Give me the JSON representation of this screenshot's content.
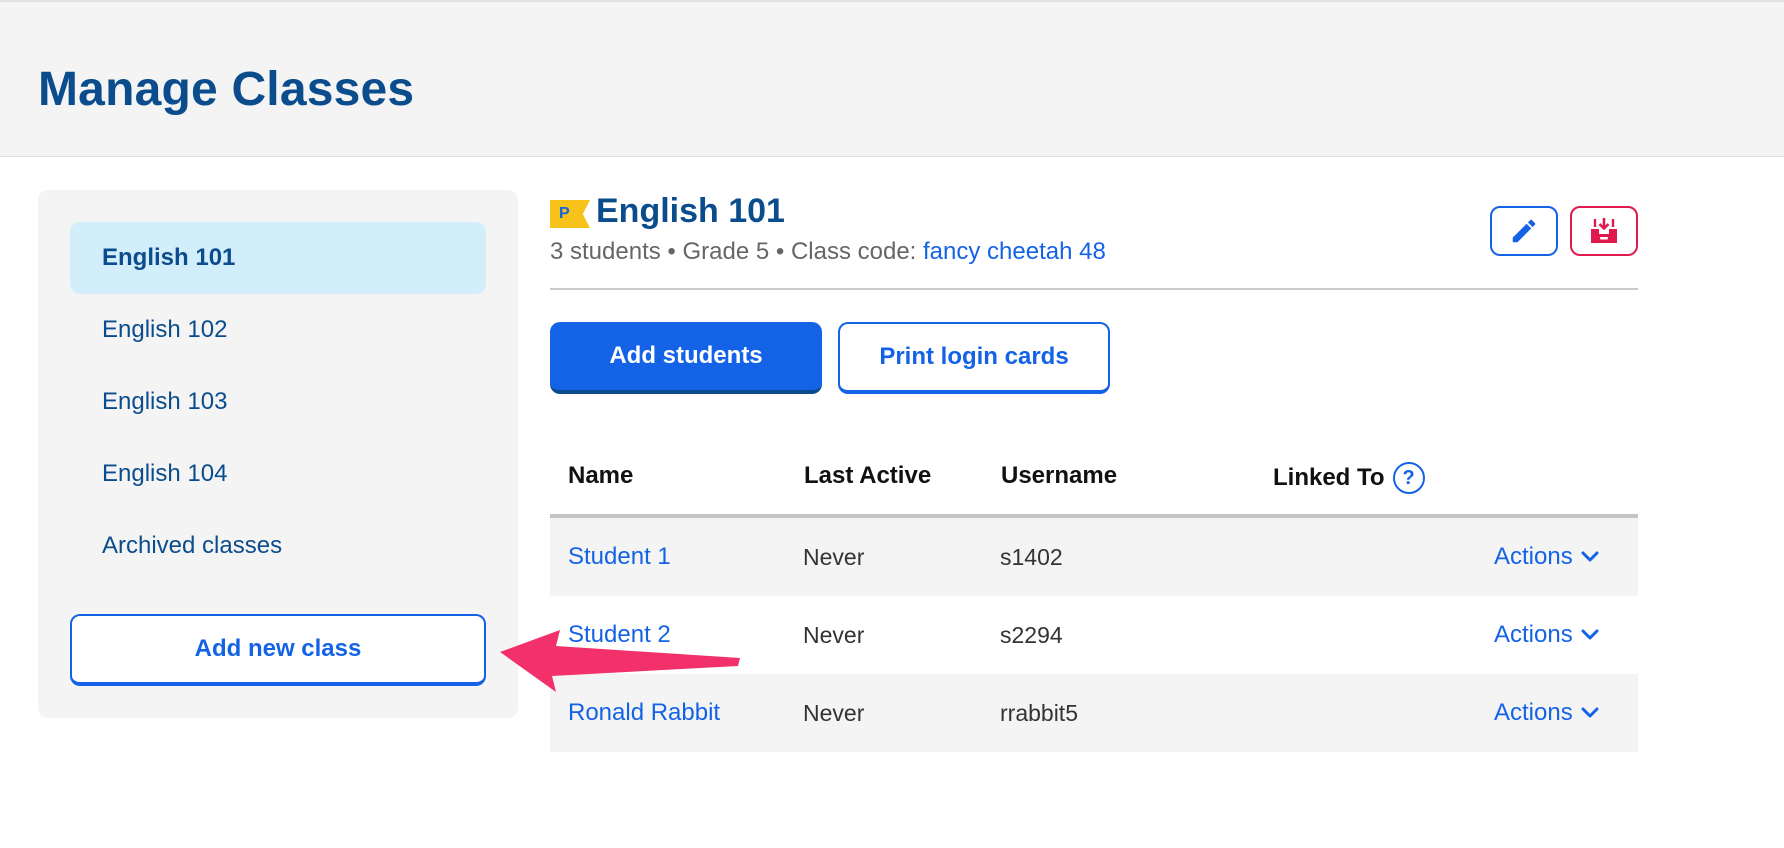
{
  "page": {
    "title": "Manage Classes"
  },
  "sidebar": {
    "items": [
      {
        "label": "English 101",
        "active": true
      },
      {
        "label": "English 102",
        "active": false
      },
      {
        "label": "English 103",
        "active": false
      },
      {
        "label": "English 104",
        "active": false
      },
      {
        "label": "Archived classes",
        "active": false
      }
    ],
    "add_class_label": "Add new class"
  },
  "class": {
    "badge": "P",
    "name": "English 101",
    "meta": "3 students • Grade 5 • Class code: ",
    "code": "fancy cheetah 48",
    "edit_icon": "pencil-icon",
    "archive_icon": "archive-box-icon"
  },
  "buttons": {
    "add_students": "Add students",
    "print_cards": "Print login cards"
  },
  "table": {
    "headers": {
      "name": "Name",
      "last_active": "Last Active",
      "username": "Username",
      "linked_to": "Linked To",
      "help": "?"
    },
    "rows": [
      {
        "name": "Student 1",
        "last_active": "Never",
        "username": "s1402",
        "actions": "Actions"
      },
      {
        "name": "Student 2",
        "last_active": "Never",
        "username": "s2294",
        "actions": "Actions"
      },
      {
        "name": "Ronald Rabbit",
        "last_active": "Never",
        "username": "rrabbit5",
        "actions": "Actions"
      }
    ]
  },
  "colors": {
    "brand_dark": "#0b4c8c",
    "brand_blue": "#1463e6",
    "active_bg": "#d3eefb",
    "archive_red": "#e0194f",
    "premium_yellow": "#f7c21a",
    "annotation_arrow": "#f2306a"
  }
}
